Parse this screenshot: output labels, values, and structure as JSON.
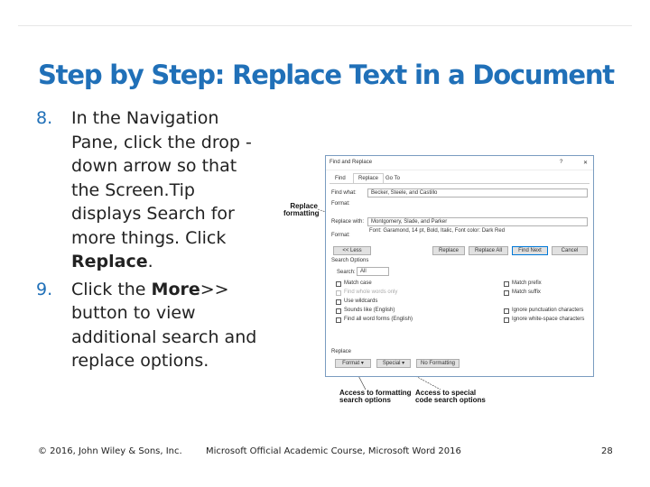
{
  "title": "Step by Step: Replace Text in a Document",
  "steps": [
    {
      "num": "8.",
      "parts": [
        "In the Navigation Pane, click the drop -down arrow so that the Screen.Tip displays Search for more things. Click ",
        "Replace",
        "."
      ]
    },
    {
      "num": "9.",
      "parts": [
        "Click the ",
        "More",
        ">> button to view additional search and replace options."
      ]
    }
  ],
  "dialog": {
    "title": "Find and Replace",
    "help": "?",
    "close": "✕",
    "tabs": [
      "Find",
      "Replace",
      "Go To"
    ],
    "find_label": "Find what:",
    "find_value": "Becker, Steele, and Castillo",
    "format_label": "Format:",
    "replace_label": "Replace with:",
    "replace_value": "Montgomery, Slade, and Parker",
    "replace_format": "Font: Garamond, 14 pt, Bold, Italic, Font color: Dark Red",
    "buttons": {
      "less": "<< Less",
      "replace": "Replace",
      "replace_all": "Replace All",
      "find_next": "Find Next",
      "cancel": "Cancel"
    },
    "search_options": "Search Options",
    "search_label": "Search:",
    "search_value": "All",
    "left_options": [
      "Match case",
      "Find whole words only",
      "Use wildcards",
      "Sounds like (English)",
      "Find all word forms (English)"
    ],
    "right_options": [
      "Match prefix",
      "Match suffix",
      "Ignore punctuation characters",
      "Ignore white-space characters"
    ],
    "replace_section": "Replace",
    "format_btn": "Format ▾",
    "special_btn": "Special ▾",
    "no_formatting": "No Formatting"
  },
  "callouts": {
    "replace_formatting": "Replace formatting",
    "formatting": "Access to formatting search options",
    "special": "Access to special code search options"
  },
  "footer": {
    "copyright": "© 2016, John Wiley & Sons, Inc.",
    "course": "Microsoft Official Academic Course, Microsoft Word 2016",
    "page": "28"
  }
}
